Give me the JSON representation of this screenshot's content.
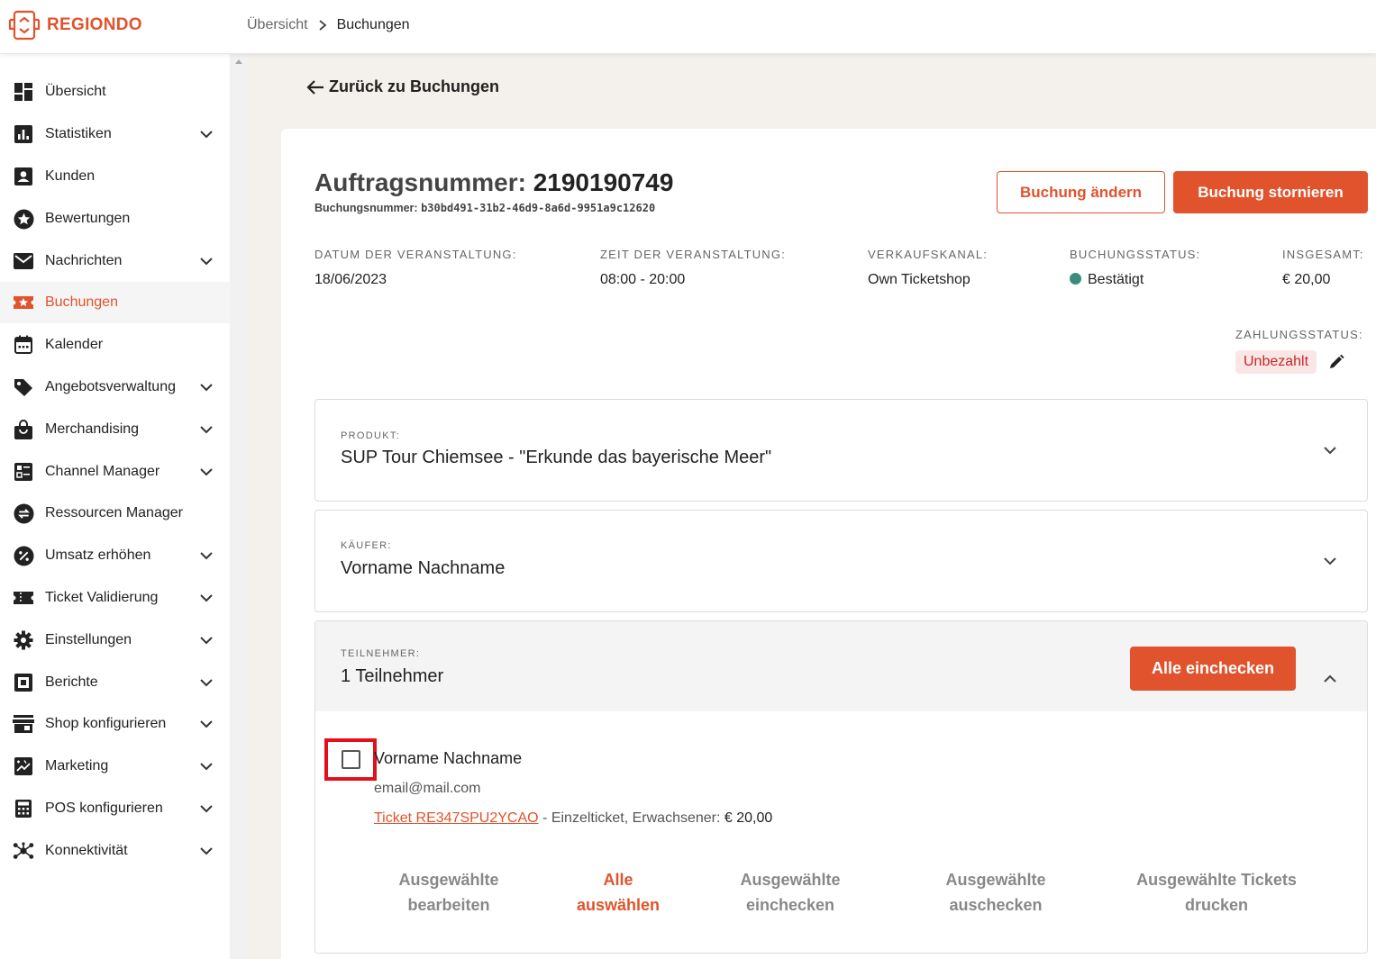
{
  "app": {
    "logo_text": "REGIONDO",
    "brand_color": "#e0532c"
  },
  "breadcrumb": {
    "items": [
      "Übersicht",
      "Buchungen"
    ]
  },
  "sidebar": {
    "items": [
      {
        "label": "Übersicht",
        "icon": "dashboard-icon",
        "expandable": false,
        "active": false
      },
      {
        "label": "Statistiken",
        "icon": "bar-chart-icon",
        "expandable": true,
        "active": false
      },
      {
        "label": "Kunden",
        "icon": "contact-card-icon",
        "expandable": false,
        "active": false
      },
      {
        "label": "Bewertungen",
        "icon": "star-icon",
        "expandable": false,
        "active": false
      },
      {
        "label": "Nachrichten",
        "icon": "mail-icon",
        "expandable": true,
        "active": false
      },
      {
        "label": "Buchungen",
        "icon": "ticket-star-icon",
        "expandable": false,
        "active": true
      },
      {
        "label": "Kalender",
        "icon": "calendar-icon",
        "expandable": false,
        "active": false
      },
      {
        "label": "Angebotsverwaltung",
        "icon": "tag-icon",
        "expandable": true,
        "active": false
      },
      {
        "label": "Merchandising",
        "icon": "shopping-bag-icon",
        "expandable": true,
        "active": false
      },
      {
        "label": "Channel Manager",
        "icon": "dashboard-list-icon",
        "expandable": true,
        "active": false
      },
      {
        "label": "Ressourcen Manager",
        "icon": "swap-icon",
        "expandable": false,
        "active": false
      },
      {
        "label": "Umsatz erhöhen",
        "icon": "percent-icon",
        "expandable": true,
        "active": false
      },
      {
        "label": "Ticket Validierung",
        "icon": "ticket-icon",
        "expandable": true,
        "active": false
      },
      {
        "label": "Einstellungen",
        "icon": "gear-icon",
        "expandable": true,
        "active": false
      },
      {
        "label": "Berichte",
        "icon": "report-icon",
        "expandable": true,
        "active": false
      },
      {
        "label": "Shop konfigurieren",
        "icon": "storefront-icon",
        "expandable": true,
        "active": false
      },
      {
        "label": "Marketing",
        "icon": "marketing-icon",
        "expandable": true,
        "active": false
      },
      {
        "label": "POS konfigurieren",
        "icon": "calculator-icon",
        "expandable": true,
        "active": false
      },
      {
        "label": "Konnektivität",
        "icon": "network-icon",
        "expandable": true,
        "active": false
      }
    ]
  },
  "back_link": "Zurück zu Buchungen",
  "order": {
    "title_prefix": "Auftragsnummer:",
    "order_number": "2190190749",
    "booking_label": "Buchungsnummer:",
    "booking_number": "b30bd491-31b2-46d9-8a6d-9951a9c12620",
    "edit_button": "Buchung ändern",
    "cancel_button": "Buchung stornieren"
  },
  "info": {
    "event_date_label": "DATUM DER VERANSTALTUNG:",
    "event_date": "18/06/2023",
    "event_time_label": "ZEIT DER VERANSTALTUNG:",
    "event_time": "08:00 - 20:00",
    "channel_label": "VERKAUFSKANAL:",
    "channel": "Own Ticketshop",
    "status_label": "BUCHUNGSSTATUS:",
    "status": "Bestätigt",
    "status_color": "#3c8c7c",
    "total_label": "INSGESAMT:",
    "total": "€ 20,00",
    "payment_label": "ZAHLUNGSSTATUS:",
    "payment_status": "Unbezahlt"
  },
  "product": {
    "label": "PRODUKT:",
    "value": "SUP Tour Chiemsee - \"Erkunde das bayerische Meer\""
  },
  "buyer": {
    "label": "KÄUFER:",
    "value": "Vorname Nachname"
  },
  "participants": {
    "label": "TEILNEHMER:",
    "value": "1 Teilnehmer",
    "checkin_all_button": "Alle einchecken",
    "items": [
      {
        "name": "Vorname Nachname",
        "email": "email@mail.com",
        "ticket_link": "Ticket RE347SPU2YCAO",
        "ticket_info": " - Einzelticket, Erwachsener: ",
        "ticket_price": "€ 20,00",
        "checked": false
      }
    ],
    "actions": [
      {
        "line1": "Ausgewählte",
        "line2": "bearbeiten"
      },
      {
        "line1": "Alle",
        "line2": "auswählen"
      },
      {
        "line1": "Ausgewählte",
        "line2": "einchecken"
      },
      {
        "line1": "Ausgewählte",
        "line2": "auschecken"
      },
      {
        "line1": "Ausgewählte Tickets",
        "line2": "drucken"
      }
    ]
  }
}
